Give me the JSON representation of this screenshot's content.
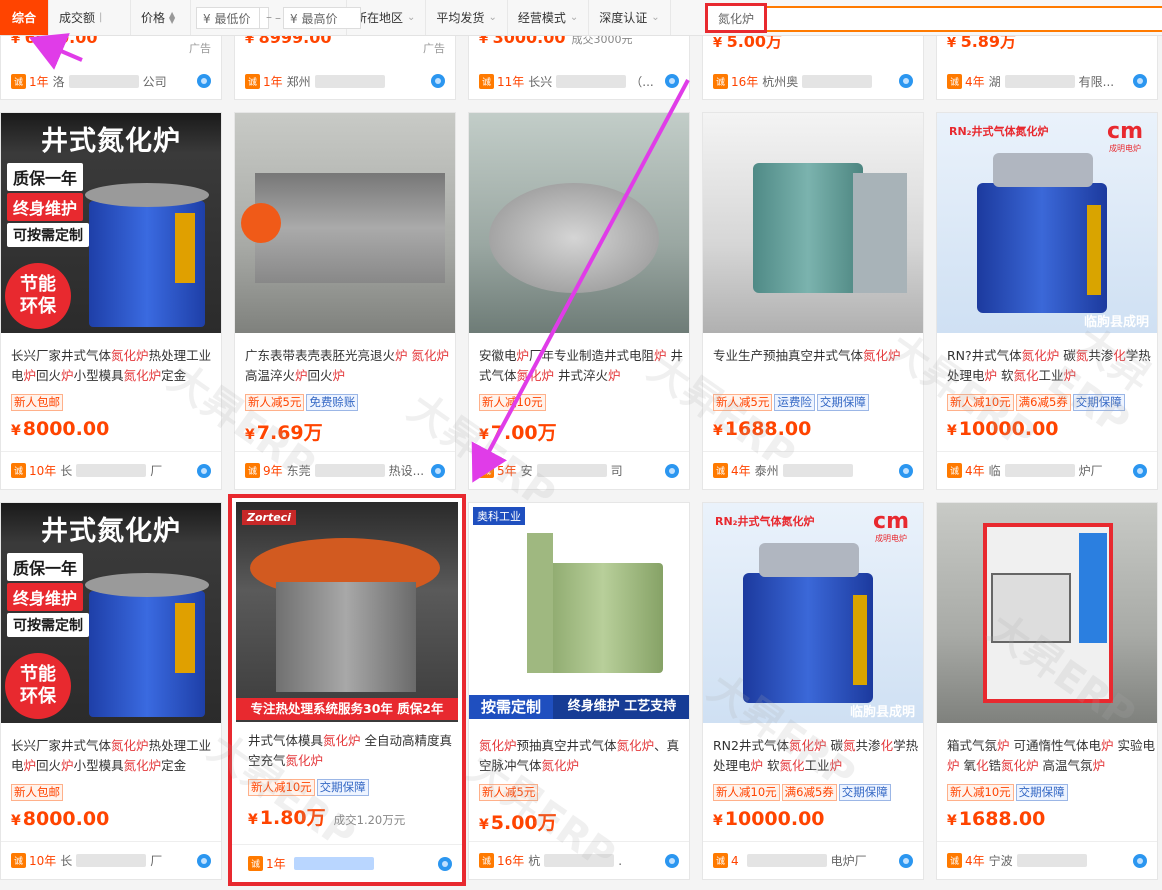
{
  "toolbar": {
    "sort_default": "综合",
    "sort_volume": "成交额",
    "sort_price": "价格",
    "price_min_placeholder": "¥ 最低价",
    "price_sep": "–",
    "price_max_placeholder": "¥ 最高价",
    "filter_location": "所在地区",
    "filter_shipping": "平均发货",
    "filter_business": "经营模式",
    "filter_verify": "深度认证",
    "search_keyword": "氮化炉"
  },
  "top_row": [
    {
      "price": "6900.00",
      "ad": "广告",
      "years": "1年",
      "seller": "洛",
      "seller_end": "公司"
    },
    {
      "price": "8999.00",
      "ad": "广告",
      "years": "1年",
      "seller": "郑州",
      "seller_end": ""
    },
    {
      "price": "3000.00",
      "sold": "成交3000元",
      "years": "11年",
      "seller": "长兴",
      "seller_end": "（..."
    },
    {
      "price": "5.00万",
      "years": "16年",
      "seller": "杭州奥",
      "seller_end": ""
    },
    {
      "price": "5.89万",
      "years": "4年",
      "seller": "湖",
      "seller_end": "有限..."
    }
  ],
  "rows": [
    [
      {
        "title": "长兴厂家井式气体氮化炉热处理工业电炉回火炉小型模具氮化炉定金",
        "tags": [
          {
            "t": "新人包邮",
            "c": "red"
          }
        ],
        "price": "8000.00",
        "sold": "",
        "years": "10年",
        "seller": "长",
        "seller_end": "厂",
        "img": {
          "title": "井式氮化炉",
          "l1": "质保一年",
          "l2": "终身维护",
          "l3": "可按需定制",
          "circle": "节能环保"
        }
      },
      {
        "title": "广东表带表壳表胚光亮退火炉 氮化炉高温淬火炉回火炉",
        "tags": [
          {
            "t": "新人减5元",
            "c": "red"
          },
          {
            "t": "免费赊账",
            "c": "blue"
          }
        ],
        "price": "7.69万",
        "sold": "",
        "years": "9年",
        "seller": "东莞",
        "seller_end": "热设..."
      },
      {
        "title": "安徽电炉厂年专业制造井式电阻炉 井式气体氮化炉 井式淬火炉",
        "tags": [
          {
            "t": "新人减10元",
            "c": "red"
          }
        ],
        "price": "7.00万",
        "sold": "",
        "years": "5年",
        "seller": "安",
        "seller_end": "司"
      },
      {
        "title": "专业生产预抽真空井式气体氮化炉",
        "tags": [
          {
            "t": "新人减5元",
            "c": "red"
          },
          {
            "t": "运费险",
            "c": "blue"
          },
          {
            "t": "交期保障",
            "c": "blue"
          }
        ],
        "price": "1688.00",
        "sold": "",
        "years": "4年",
        "seller": "泰州",
        "seller_end": ""
      },
      {
        "title": "RN?井式气体氮化炉 碳氮共渗化学热处理电炉 软氮化工业炉",
        "tags": [
          {
            "t": "新人减10元",
            "c": "red"
          },
          {
            "t": "满6减5券",
            "c": "red"
          },
          {
            "t": "交期保障",
            "c": "blue"
          }
        ],
        "price": "10000.00",
        "sold": "",
        "years": "4年",
        "seller": "临",
        "seller_end": "炉厂",
        "img": {
          "caption": "RN₂井式气体氮化炉",
          "logo": "cm",
          "logo_sub": "成明电炉",
          "bottom": "临朐县成明"
        }
      }
    ],
    [
      {
        "title": "长兴厂家井式气体氮化炉热处理工业电炉回火炉小型模具氮化炉定金",
        "tags": [
          {
            "t": "新人包邮",
            "c": "red"
          }
        ],
        "price": "8000.00",
        "sold": "",
        "years": "10年",
        "seller": "长",
        "seller_end": "厂",
        "img": {
          "title": "井式氮化炉",
          "l1": "质保一年",
          "l2": "终身维护",
          "l3": "可按需定制",
          "circle": "节能环保"
        }
      },
      {
        "title": "井式气体模具氮化炉 全自动高精度真空充气氮化炉",
        "tags": [
          {
            "t": "新人减10元",
            "c": "red"
          },
          {
            "t": "交期保障",
            "c": "blue"
          }
        ],
        "price": "1.80万",
        "sold": "成交1.20万元",
        "years": "1年",
        "seller": "",
        "seller_end": "",
        "img": {
          "brand": "Zorteci",
          "banner": "专注热处理系统服务30年  质保2年"
        }
      },
      {
        "title": "氮化炉预抽真空井式气体氮化炉、真空脉冲气体氮化炉",
        "tags": [
          {
            "t": "新人减5元",
            "c": "red"
          }
        ],
        "price": "5.00万",
        "sold": "",
        "years": "16年",
        "seller": "杭",
        "seller_end": ".",
        "img": {
          "corner": "奥科工业",
          "b1": "按需定制",
          "b2": "终身维护 工艺支持"
        }
      },
      {
        "title": "RN2井式气体氮化炉 碳氮共渗化学热处理电炉 软氮化工业炉",
        "tags": [
          {
            "t": "新人减10元",
            "c": "red"
          },
          {
            "t": "满6减5券",
            "c": "red"
          },
          {
            "t": "交期保障",
            "c": "blue"
          }
        ],
        "price": "10000.00",
        "sold": "",
        "years": "4",
        "seller": "",
        "seller_end": "电炉厂",
        "img": {
          "caption": "RN₂井式气体氮化炉",
          "logo": "cm",
          "logo_sub": "成明电炉",
          "bottom": "临朐县成明"
        }
      },
      {
        "title": "箱式气氛炉 可通惰性气体电炉 实验电炉 氧化锆氮化炉 高温气氛炉",
        "tags": [
          {
            "t": "新人减10元",
            "c": "red"
          },
          {
            "t": "交期保障",
            "c": "blue"
          }
        ],
        "price": "1688.00",
        "sold": "",
        "years": "4年",
        "seller": "宁波",
        "seller_end": ""
      }
    ]
  ],
  "watermark": "大昇ERP",
  "colors": {
    "accent": "#ff4400",
    "highlight_box": "#e8292f",
    "annotation_arrow": "#e03ce8"
  }
}
